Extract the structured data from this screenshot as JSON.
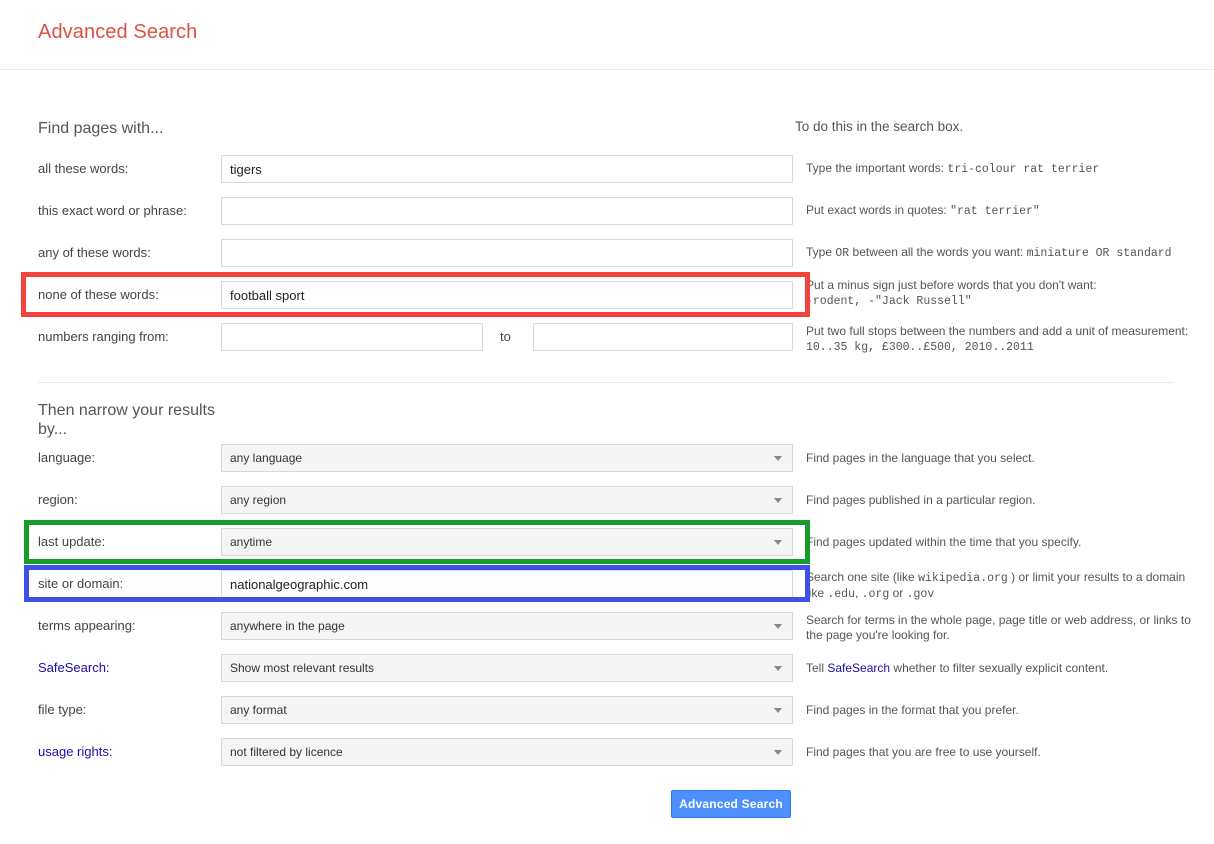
{
  "header": {
    "title": "Advanced Search",
    "title_color": "#dd5145"
  },
  "find_section": {
    "heading": "Find pages with...",
    "hint_heading": "To do this in the search box.",
    "rows": [
      {
        "label": "all these words:",
        "value": "tigers",
        "placeholder": "",
        "hint_prefix": "Type the important words:",
        "hint_mono": "tri-colour rat terrier",
        "hint_suffix": ""
      },
      {
        "label": "this exact word or phrase:",
        "value": "",
        "placeholder": "",
        "hint_prefix": "Put exact words in quotes:",
        "hint_mono": "\"rat terrier\"",
        "hint_suffix": ""
      },
      {
        "label": "any of these words:",
        "value": "",
        "placeholder": "",
        "hint_prefix": "Type",
        "hint_mono": "OR",
        "hint_suffix": "between all the words you want:",
        "hint_mono2": "miniature OR standard"
      },
      {
        "label": "none of these words:",
        "value": "football sport",
        "placeholder": "",
        "hint_prefix": "Put a minus sign just before words that you don't want:",
        "hint_mono": "-rodent, -\"Jack Russell\"",
        "hint_suffix": ""
      }
    ],
    "numbers_row": {
      "label": "numbers ranging from:",
      "from_value": "",
      "to_label": "to",
      "to_value": "",
      "hint_prefix": "Put two full stops between the numbers and add a unit of measurement:",
      "hint_mono": "10..35 kg, £300..£500, 2010..2011"
    }
  },
  "narrow_section": {
    "heading_line1": "Then narrow your results",
    "heading_line2": "by...",
    "rows": [
      {
        "label": "language:",
        "type": "select",
        "value": "any language",
        "hint": "Find pages in the language that you select."
      },
      {
        "label": "region:",
        "type": "select",
        "value": "any region",
        "hint": "Find pages published in a particular region."
      },
      {
        "label": "last update:",
        "type": "select",
        "value": "anytime",
        "hint": "Find pages updated within the time that you specify."
      },
      {
        "label": "site or domain:",
        "type": "input",
        "value": "nationalgeographic.com",
        "hint_part1": "Search one site (like",
        "hint_mono1": "wikipedia.org",
        "hint_part2": ") or limit your results to a domain like",
        "hint_mono2": ".edu",
        "hint_part3": ",",
        "hint_mono3": ".org",
        "hint_part4": "or",
        "hint_mono4": ".gov"
      },
      {
        "label": "terms appearing:",
        "type": "select",
        "value": "anywhere in the page",
        "hint": "Search for terms in the whole page, page title or web address, or links to the page you're looking for."
      },
      {
        "label": "SafeSearch:",
        "label_is_link": true,
        "type": "select",
        "value": "Show most relevant results",
        "hint_part1": "Tell",
        "hint_link": "SafeSearch",
        "hint_part2": "whether to filter sexually explicit content."
      },
      {
        "label": "file type:",
        "type": "select",
        "value": "any format",
        "hint": "Find pages in the format that you prefer."
      },
      {
        "label": "usage rights:",
        "label_is_link": true,
        "type": "select",
        "value": "not filtered by licence",
        "hint": "Find pages that you are free to use yourself."
      }
    ]
  },
  "submit": {
    "label": "Advanced Search",
    "color": "#4d90fe"
  },
  "annotations": [
    {
      "name": "none-of-these-words-highlight",
      "color": "#f4433c"
    },
    {
      "name": "last-update-highlight",
      "color": "#169c29"
    },
    {
      "name": "site-or-domain-highlight",
      "color": "#3d51e8"
    }
  ]
}
